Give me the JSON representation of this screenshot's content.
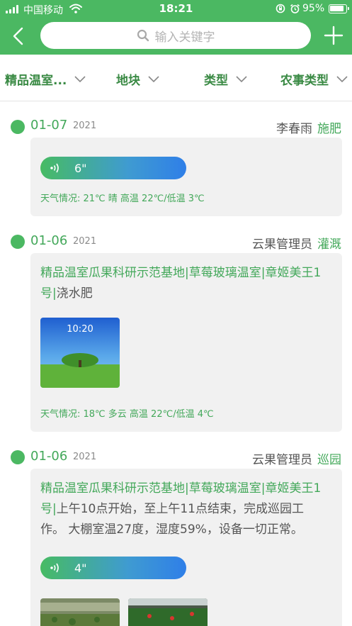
{
  "status_bar": {
    "carrier": "中国移动",
    "time": "18:21",
    "battery": "95%"
  },
  "header": {
    "search_placeholder": "输入关键字"
  },
  "filters": [
    {
      "label": "精品温室..."
    },
    {
      "label": "地块"
    },
    {
      "label": "类型"
    },
    {
      "label": "农事类型"
    }
  ],
  "entries": [
    {
      "date": "01-07",
      "year": "2021",
      "person": "李春雨",
      "activity": "施肥",
      "voice_duration": "6\"",
      "weather": "天气情况: 21℃ 晴 高温 22℃/低温 3℃"
    },
    {
      "date": "01-06",
      "year": "2021",
      "person": "云果管理员",
      "activity": "灌溉",
      "location_line1": "精品温室瓜果科研示范基地|草莓玻璃温室|章姬美王1",
      "location_line2": "号|",
      "note_line1": "浇水肥",
      "photo_time": "10:20",
      "weather": "天气情况: 18℃ 多云 高温 22℃/低温 4℃"
    },
    {
      "date": "01-06",
      "year": "2021",
      "person": "云果管理员",
      "activity": "巡园",
      "location_line1": "精品温室瓜果科研示范基地|草莓玻璃温室|章姬美王1",
      "location_line2": "号|",
      "note_line1": "上午10点开始，至上午11点结束，完成巡园工",
      "note_line2": "作。 大棚室温27度，湿度59%，设备一切正常。",
      "voice_duration": "4\""
    }
  ]
}
